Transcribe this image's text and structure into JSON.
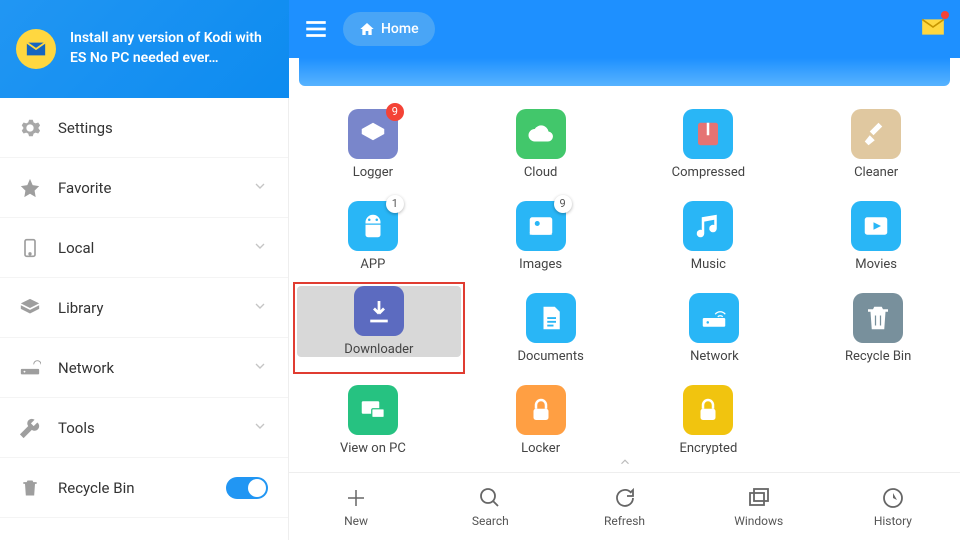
{
  "promo": {
    "line": "Install any version of Kodi with ES No PC needed ever…"
  },
  "topbar": {
    "home": "Home"
  },
  "sidebar": {
    "items": [
      {
        "label": "Settings"
      },
      {
        "label": "Favorite"
      },
      {
        "label": "Local"
      },
      {
        "label": "Library"
      },
      {
        "label": "Network"
      },
      {
        "label": "Tools"
      },
      {
        "label": "Recycle Bin"
      }
    ]
  },
  "grid": {
    "rows": [
      [
        {
          "label": "Logger",
          "color": "#7986cb",
          "badge": "9",
          "badgeKind": "red",
          "icon": "layers"
        },
        {
          "label": "Cloud",
          "color": "#42c76b",
          "icon": "cloud"
        },
        {
          "label": "Compressed",
          "color": "#29b6f6",
          "icon": "zip"
        },
        {
          "label": "Cleaner",
          "color": "#e0c8a0",
          "icon": "broom"
        }
      ],
      [
        {
          "label": "APP",
          "color": "#29b6f6",
          "badge": "1",
          "badgeKind": "white",
          "icon": "android"
        },
        {
          "label": "Images",
          "color": "#29b6f6",
          "badge": "9",
          "badgeKind": "white",
          "icon": "image"
        },
        {
          "label": "Music",
          "color": "#29b6f6",
          "icon": "music"
        },
        {
          "label": "Movies",
          "color": "#29b6f6",
          "icon": "movie"
        }
      ],
      [
        {
          "label": "Downloader",
          "color": "#5c6bc0",
          "icon": "download",
          "selected": true
        },
        {
          "label": "Documents",
          "color": "#29b6f6",
          "icon": "doc"
        },
        {
          "label": "Network",
          "color": "#29b6f6",
          "icon": "router"
        },
        {
          "label": "Recycle Bin",
          "color": "#78909c",
          "icon": "trash"
        }
      ],
      [
        {
          "label": "View on PC",
          "color": "#26c281",
          "icon": "pc"
        },
        {
          "label": "Locker",
          "color": "#ff9f43",
          "icon": "lock"
        },
        {
          "label": "Encrypted",
          "color": "#f1c40f",
          "icon": "lock2"
        },
        {
          "label": "",
          "empty": true
        }
      ]
    ]
  },
  "bottombar": {
    "items": [
      {
        "label": "New"
      },
      {
        "label": "Search"
      },
      {
        "label": "Refresh"
      },
      {
        "label": "Windows"
      },
      {
        "label": "History"
      }
    ]
  }
}
